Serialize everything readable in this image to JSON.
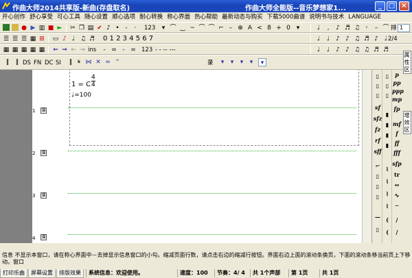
{
  "window": {
    "title_left": "作曲大师2014共享版-新曲(存盘取名)",
    "title_right": "作曲大师全能版--音乐梦想家1..."
  },
  "menu": [
    "开心创作",
    "舒心享受",
    "可心工具",
    "随心设置",
    "顺心选项",
    "耐心转换",
    "称心界面",
    "热心帮助",
    "最新动态与购买",
    "下载5000曲谱",
    "说明书与技术",
    "LANGUAGE"
  ],
  "toolbar1": {
    "num_label": "123",
    "spin_label": "排",
    "spin_value": "1"
  },
  "toolbar2": {
    "numbers": "0 1 2 3 4 5 6 7",
    "time_sig": "2/4"
  },
  "toolbar3": {
    "ins_label": "ins",
    "num_label": "123",
    "dashes": "- -  -- ---"
  },
  "toolbar4": {
    "items": [
      "DS",
      "FN",
      "DC",
      "SI"
    ],
    "lu_label": "录"
  },
  "score": {
    "key_label": "1 = C",
    "time_top": "4",
    "time_bottom": "4",
    "tempo_label": "♩=100",
    "rows": [
      "1",
      "2",
      "3",
      "4"
    ],
    "row_btn": "谱"
  },
  "palette": {
    "dyn_col1": [
      "p",
      "pp",
      "ppp",
      "mp",
      "fp",
      "mf",
      "f",
      "ff",
      "fff",
      "sfp"
    ],
    "dyn_col2": [
      "sf",
      "sfz",
      "fz",
      "rf",
      "sff"
    ],
    "tab_top": "属 性 区",
    "tab_mid": "增 效 区"
  },
  "info_text": "信息  不显示本窗口，请在称心界面中－去掉显示信息窗口的小勾。缩减页面行数，请点击右边的缩减行按钮。界面右边上面的滚动条换页，下面的滚动条移当前页上下移动。窗口",
  "status": {
    "tabs": [
      "打印乐曲",
      "屏幕设置",
      "排版效果"
    ],
    "system_info": "系统信息：欢迎使用。",
    "speed": "速度：100",
    "beat": "节奏：4/ 4",
    "voices": "共 1个声部",
    "page": "第 1页",
    "total": "共 1页"
  }
}
